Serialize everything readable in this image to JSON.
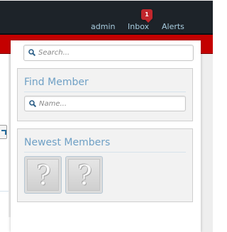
{
  "nav": {
    "admin_label": "admin",
    "inbox_label": "Inbox",
    "inbox_badge": "1",
    "alerts_label": "Alerts"
  },
  "sidebar": {
    "search": {
      "placeholder": "Search..."
    },
    "find_member": {
      "title": "Find Member",
      "placeholder": "Name..."
    },
    "newest_members": {
      "title": "Newest Members",
      "avatars": [
        "?",
        "?"
      ]
    }
  },
  "colors": {
    "topbar": "#1d2329",
    "nav_link": "#a9cde0",
    "badge": "#c1272d",
    "red_strip": "#c40000",
    "block_title": "#6fa0c5"
  },
  "icons": {
    "search": "magnifier-icon",
    "avatar_placeholder": "question-mark-avatar"
  }
}
